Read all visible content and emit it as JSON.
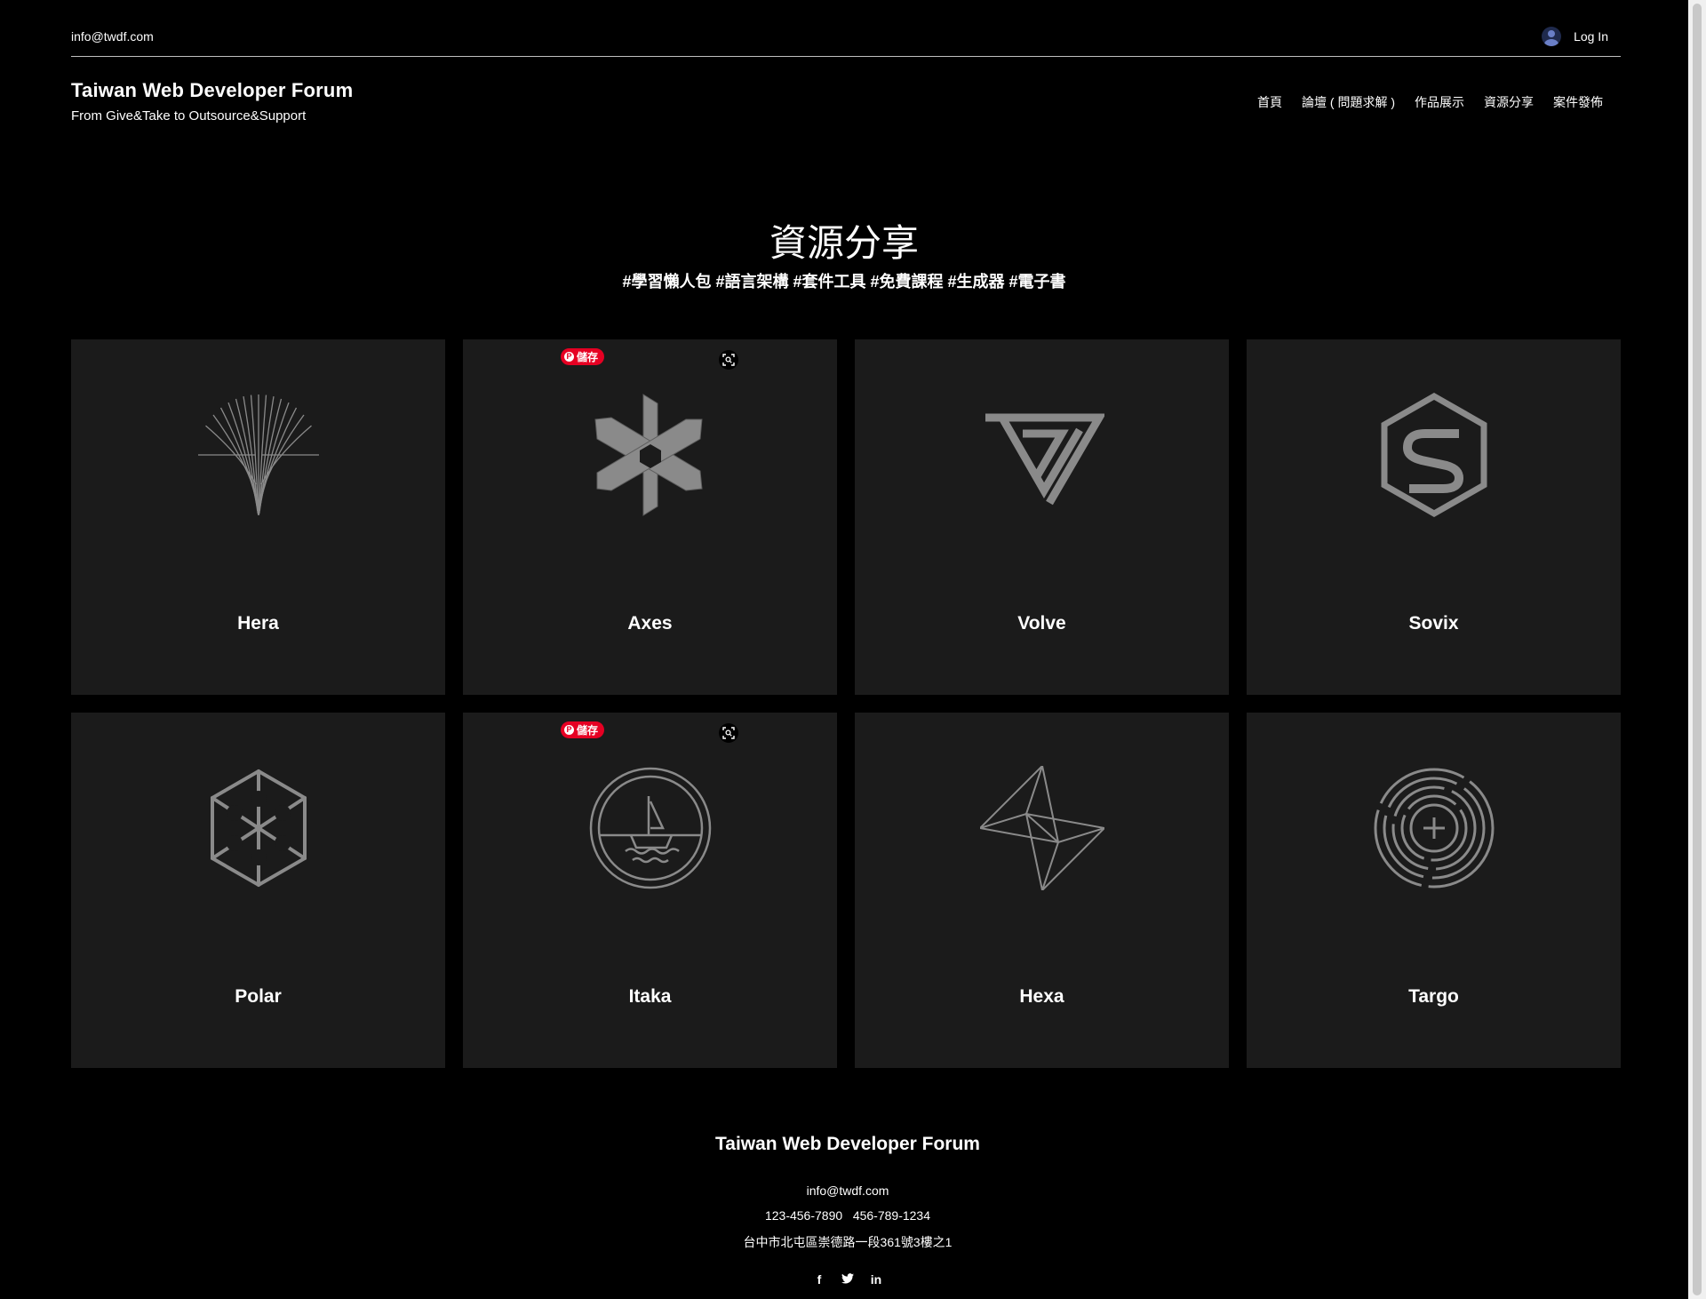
{
  "topbar": {
    "email": "info@twdf.com",
    "login_label": "Log In"
  },
  "header": {
    "title": "Taiwan Web Developer Forum",
    "subtitle": "From Give&Take to Outsource&Support",
    "nav": [
      "首頁",
      "論壇 ( 問題求解 )",
      "作品展示",
      "資源分享",
      "案件發佈"
    ]
  },
  "hero": {
    "title": "資源分享",
    "tags": "#學習懶人包 #語言架構 #套件工具 #免費課程 #生成器 #電子書"
  },
  "cards": [
    {
      "name": "Hera",
      "icon": "hera-icon"
    },
    {
      "name": "Axes",
      "icon": "axes-icon"
    },
    {
      "name": "Volve",
      "icon": "volve-icon"
    },
    {
      "name": "Sovix",
      "icon": "sovix-icon"
    },
    {
      "name": "Polar",
      "icon": "polar-icon"
    },
    {
      "name": "Itaka",
      "icon": "itaka-icon"
    },
    {
      "name": "Hexa",
      "icon": "hexa-icon"
    },
    {
      "name": "Targo",
      "icon": "targo-icon"
    }
  ],
  "pinterest": {
    "save_label": "儲存"
  },
  "footer": {
    "title": "Taiwan Web Developer Forum",
    "email": "info@twdf.com",
    "phones": "123-456-7890   456-789-1234",
    "address": "台中市北屯區崇德路一段361號3樓之1",
    "social": [
      "f",
      "t",
      "in"
    ]
  },
  "colors": {
    "background": "#000000",
    "card": "#1b1b1b",
    "logo_stroke": "#8a8a8a",
    "pinterest_red": "#e60023"
  }
}
